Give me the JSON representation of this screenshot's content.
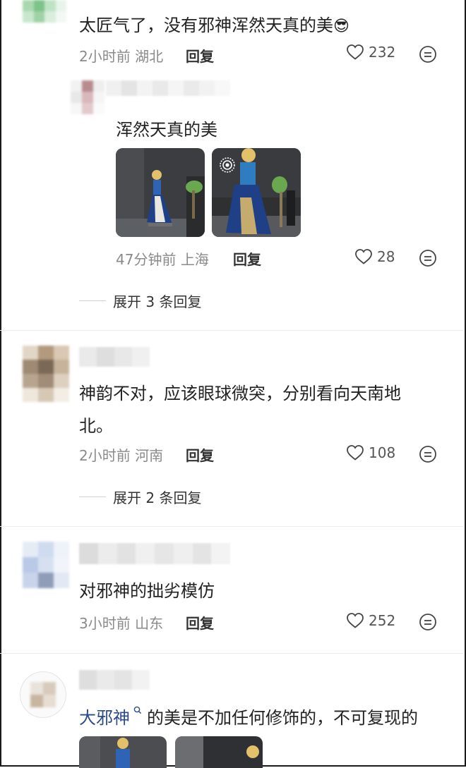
{
  "comments": [
    {
      "text": "太匠气了，没有邪神浑然天真的美",
      "emoji": "😎",
      "time": "2小时前",
      "location": "湖北",
      "reply_label": "回复",
      "likes": "232"
    },
    {
      "text": "浑然天真的美",
      "time": "47分钟前",
      "location": "上海",
      "reply_label": "回复",
      "likes": "28",
      "expand": "展开 3 条回复"
    },
    {
      "text_line1": "神韵不对，应该眼球微突，分别看向天南地",
      "text_line2": "北。",
      "time": "2小时前",
      "location": "河南",
      "reply_label": "回复",
      "likes": "108",
      "expand": "展开 2 条回复"
    },
    {
      "text": "对邪神的拙劣模仿",
      "time": "3小时前",
      "location": "山东",
      "reply_label": "回复",
      "likes": "252"
    },
    {
      "link_text": "大邪神",
      "text": "的美是不加任何修饰的，不可复现的"
    }
  ],
  "colors": {
    "link": "#2b4a8b",
    "meta": "#8a8a8a",
    "text": "#222222"
  }
}
